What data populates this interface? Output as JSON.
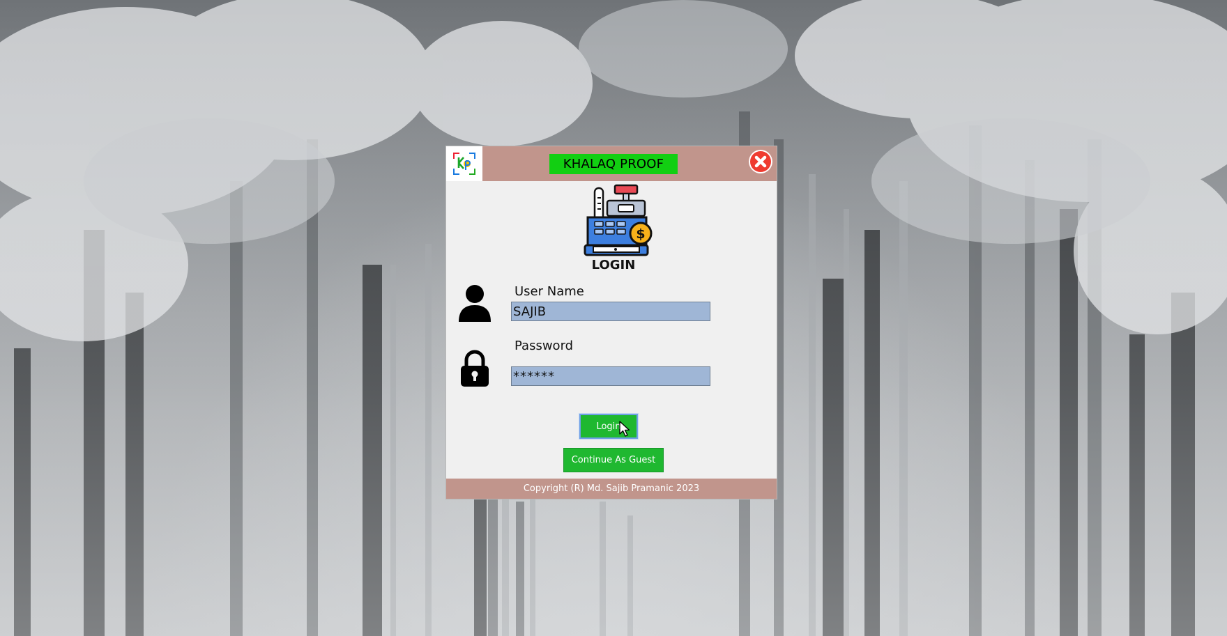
{
  "window": {
    "title": "KHALAQ PROOF",
    "logo_text": "KP",
    "close_icon": "close-icon"
  },
  "header": {
    "illustration_icon": "cash-register-icon",
    "heading": "LOGIN"
  },
  "form": {
    "username_label": "User Name",
    "username_value": "SAJIB",
    "password_label": "Password",
    "password_value": "******"
  },
  "buttons": {
    "login_label": "Login",
    "guest_label": "Continue As Guest"
  },
  "footer": {
    "copyright": "Copyright (R) Md. Sajib Pramanic 2023"
  },
  "colors": {
    "titlebar": "#c1958c",
    "title_badge": "#12cf12",
    "button_green": "#1fb830",
    "input_fill": "#9fb6d6",
    "close_red": "#ef3b30"
  }
}
